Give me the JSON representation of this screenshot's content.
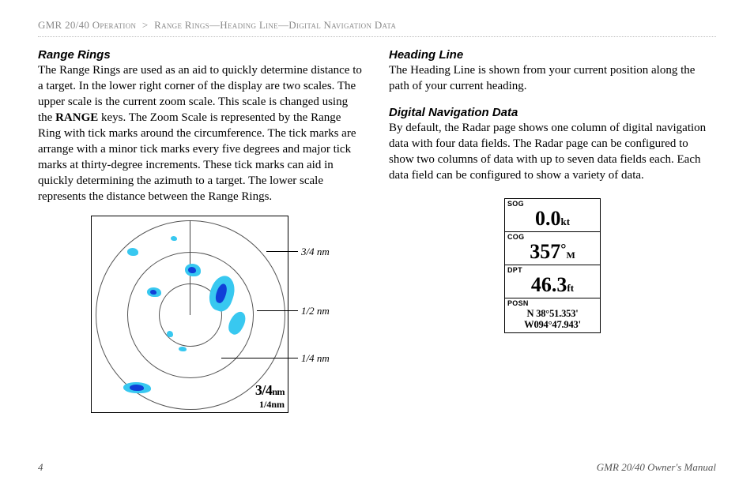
{
  "breadcrumb": {
    "section": "GMR 20/40 Operation",
    "sep": ">",
    "topic": "Range Rings—Heading Line—Digital Navigation Data"
  },
  "left": {
    "heading": "Range Rings",
    "body_a": "The Range Rings are used as an aid to quickly determine distance to a target. In the lower right corner of the display are two scales. The upper scale is the current zoom scale. This scale is changed using the ",
    "range_keyword": "RANGE",
    "body_b": " keys. The Zoom Scale is represented by the Range Ring with tick marks around the circumference. The tick marks are arrange with a minor tick marks every five degrees and major tick marks at thirty-degree increments. These tick marks can aid in quickly determining the azimuth to a target. The lower scale represents the distance between the Range Rings."
  },
  "right": {
    "heading1": "Heading Line",
    "body1": "The Heading Line is shown from your current position along the path of your current heading.",
    "heading2": "Digital Navigation Data",
    "body2": "By default, the Radar page shows one column of digital navigation data with four data fields. The Radar page can be configured to show two columns of data with up to seven data fields each. Each data field can be configured to show a variety of data."
  },
  "radar": {
    "callouts": {
      "outer": "3/4 nm",
      "middle": "1/2 nm",
      "inner": "1/4 nm"
    },
    "zoom_scale": "3/4",
    "zoom_unit": "nm",
    "ring_scale": "1/4",
    "ring_unit": "nm"
  },
  "nav_panel": {
    "sog": {
      "label": "SOG",
      "value": "0.0",
      "unit": "kt"
    },
    "cog": {
      "label": "COG",
      "value": "357",
      "deg": "°",
      "ref": "M"
    },
    "dpt": {
      "label": "DPT",
      "value": "46.3",
      "unit": "ft"
    },
    "posn": {
      "label": "POSN",
      "lat": "N  38°51.353'",
      "lon": "W094°47.943'"
    }
  },
  "footer": {
    "page": "4",
    "doc": "GMR 20/40 Owner's Manual"
  }
}
